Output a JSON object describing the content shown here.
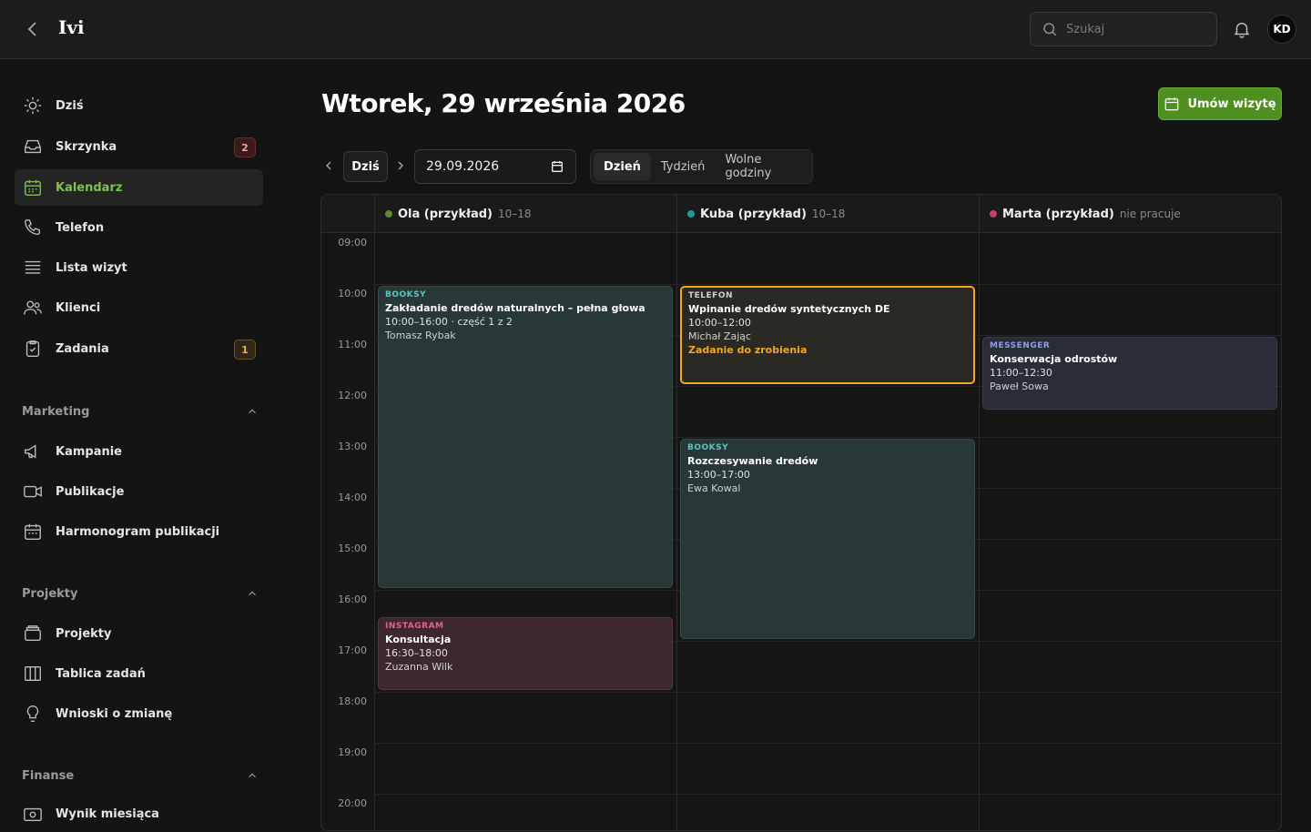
{
  "header": {
    "brand": "Ivi",
    "search_placeholder": "Szukaj",
    "avatar": "KD"
  },
  "sidebar": {
    "items": [
      {
        "label": "Dziś",
        "icon": "sun-icon"
      },
      {
        "label": "Skrzynka",
        "icon": "inbox-icon",
        "badge": "2"
      },
      {
        "label": "Kalendarz",
        "icon": "calendar-icon",
        "active": true
      },
      {
        "label": "Telefon",
        "icon": "phone-icon"
      },
      {
        "label": "Lista wizyt",
        "icon": "list-icon"
      },
      {
        "label": "Klienci",
        "icon": "users-icon"
      },
      {
        "label": "Zadania",
        "icon": "clipboard-icon",
        "badge": "1"
      }
    ],
    "marketing": {
      "title": "Marketing",
      "items": [
        {
          "label": "Kampanie",
          "icon": "megaphone-icon"
        },
        {
          "label": "Publikacje",
          "icon": "video-icon"
        },
        {
          "label": "Harmonogram publikacji",
          "icon": "calendar-icon"
        }
      ]
    },
    "projekty": {
      "title": "Projekty",
      "items": [
        {
          "label": "Projekty",
          "icon": "folder-icon"
        },
        {
          "label": "Tablica zadań",
          "icon": "columns-icon"
        },
        {
          "label": "Wnioski o zmianę",
          "icon": "lightbulb-icon"
        }
      ]
    },
    "finanse": {
      "title": "Finanse",
      "items": [
        {
          "label": "Wynik miesiąca",
          "icon": "wallet-icon"
        }
      ]
    }
  },
  "main": {
    "title": "Wtorek, 29 września 2026",
    "cta": "Umów wizytę",
    "today": "Dziś",
    "date": "29.09.2026",
    "views": [
      "Dzień",
      "Tydzień",
      "Wolne godziny"
    ],
    "selected_view": "Dzień"
  },
  "calendar": {
    "hours": [
      "09:00",
      "10:00",
      "11:00",
      "12:00",
      "13:00",
      "14:00",
      "15:00",
      "16:00",
      "17:00",
      "18:00",
      "19:00",
      "20:00"
    ],
    "columns": [
      {
        "name": "Ola (przykład)",
        "hours": "10–18",
        "dot": "#5c8a3a"
      },
      {
        "name": "Kuba (przykład)",
        "hours": "10–18",
        "dot": "#1a9a9a"
      },
      {
        "name": "Marta (przykład)",
        "hours": "nie pracuje",
        "dot": "#c0407a"
      }
    ],
    "events": [
      {
        "col": 0,
        "start": 10,
        "end": 16,
        "source": "BOOKSY",
        "title": "Zakładanie dredów naturalnych – pełna głowa",
        "time": "10:00–16:00 · część 1 z 2",
        "client": "Tomasz Rybak",
        "kind": "booksy"
      },
      {
        "col": 0,
        "start": 16.5,
        "end": 18,
        "source": "INSTAGRAM",
        "title": "Konsultacja",
        "time": "16:30–18:00",
        "client": "Zuzanna Wilk",
        "kind": "instagram"
      },
      {
        "col": 1,
        "start": 10,
        "end": 12,
        "source": "TELEFON",
        "title": "Wpinanie dredów syntetycznych DE",
        "time": "10:00–12:00",
        "client": "Michał Zając",
        "note": "Zadanie do zrobienia",
        "kind": "telefon"
      },
      {
        "col": 1,
        "start": 13,
        "end": 17,
        "source": "BOOKSY",
        "title": "Rozczesywanie dredów",
        "time": "13:00–17:00",
        "client": "Ewa Kowal",
        "kind": "booksy"
      },
      {
        "col": 2,
        "start": 11,
        "end": 12.5,
        "source": "MESSENGER",
        "title": "Konserwacja odrostów",
        "time": "11:00–12:30",
        "client": "Paweł Sowa",
        "kind": "messenger"
      }
    ]
  },
  "colors": {
    "accent": "#7fc14d",
    "cta": "#4f8f1f",
    "booksy": "#2a3a38",
    "instagram": "#3e2a32",
    "telefon": "#2c2a26",
    "messenger": "#2a2e3a",
    "telefon_border": "#f5a623"
  }
}
